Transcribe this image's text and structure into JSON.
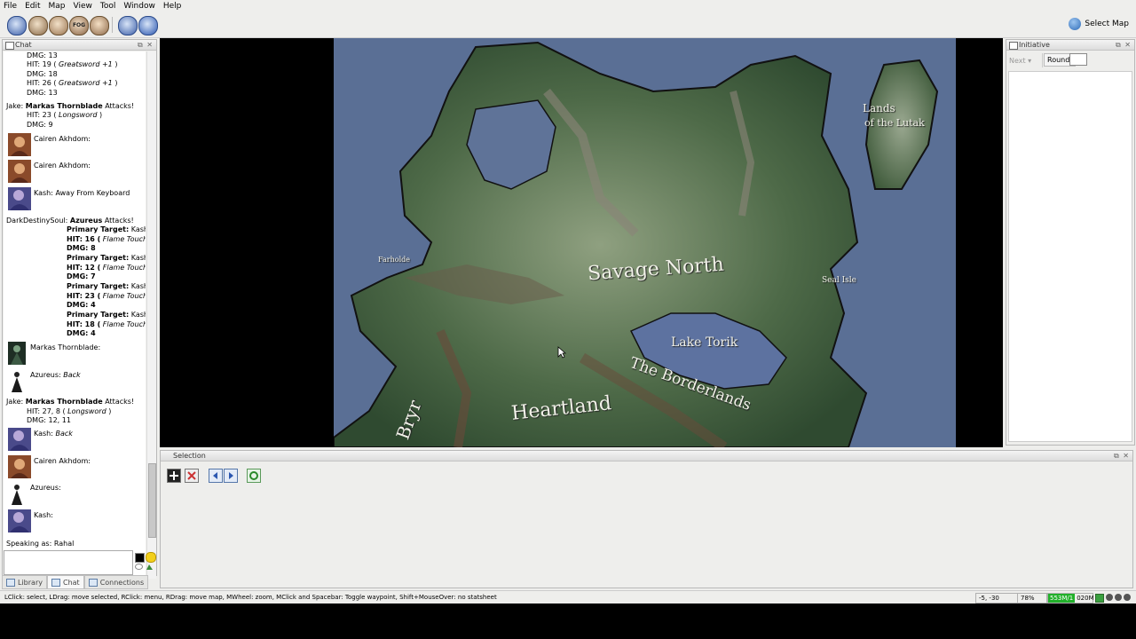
{
  "menu": [
    "File",
    "Edit",
    "Map",
    "View",
    "Tool",
    "Window",
    "Help"
  ],
  "toolbar": {
    "select_map_label": "Select Map",
    "fog_label": "FOG"
  },
  "chat": {
    "title": "Chat",
    "speaking_as": "Speaking as: Rahal",
    "lines": {
      "l1": "DMG: 13",
      "l2_pre": "HIT: 19 (",
      "l2_w": " Greatsword +1 ",
      "l2_post": ")",
      "l3": "DMG: 18",
      "l4_pre": "HIT: 26 (",
      "l4_w": " Greatsword +1 ",
      "l4_post": ")",
      "l5": "DMG: 13",
      "l6_pre": "Jake: ",
      "l6_name": "Markas Thornblade",
      "l6_post": " Attacks!",
      "l7_pre": "HIT: 23 (",
      "l7_w": " Longsword ",
      "l7_post": ")",
      "l8": "DMG: 9",
      "a1": "Cairen Akhdom:",
      "a2": "Cairen Akhdom:",
      "a3": "Kash:   Away From Keyboard",
      "d_pre": "DarkDestinySoul:  ",
      "d_name": "Azureus",
      "d_post": " Attacks!",
      "p1_lab": "Primary Target:",
      "p1_val": " Kash",
      "h1_pre": "HIT: 16 (",
      "h1_w": " Flame Touch ",
      "h1_post": ")",
      "g1": "DMG: 8",
      "p2_lab": "Primary Target:",
      "p2_val": " Kash",
      "h2_pre": "HIT: 12 (",
      "h2_w": " Flame Touch ",
      "h2_post": ")",
      "g2": "DMG: 7",
      "p3_lab": "Primary Target:",
      "p3_val": " Kash",
      "h3_pre": "HIT: 23 (",
      "h3_w": " Flame Touch ",
      "h3_post": ")",
      "g3": "DMG: 4",
      "p4_lab": "Primary Target:",
      "p4_val": " Kash",
      "h4_pre": "HIT: 18 (",
      "h4_w": " Flame Touch ",
      "h4_post": ")",
      "g4": "DMG: 4",
      "a4": "Markas Thornblade:",
      "a5_pre": "Azureus:   ",
      "a5_w": "Back",
      "j2_pre": "Jake: ",
      "j2_name": "Markas Thornblade",
      "j2_post": " Attacks!",
      "j2_hit_pre": "HIT: 27, 8 (",
      "j2_hit_w": " Longsword ",
      "j2_hit_post": ")",
      "j2_dmg": "DMG: 12, 11",
      "a6_pre": "Kash:   ",
      "a6_w": "Back",
      "a7": "Cairen Akhdom:",
      "a8": "Azureus:",
      "a9": "Kash:"
    }
  },
  "tabs": [
    "Library",
    "Chat",
    "Connections"
  ],
  "map_labels": {
    "lands_1": "Lands",
    "lands_2": "of the Lutak",
    "savage": "Savage North",
    "farholde": "Farholde",
    "seal": "Seal Isle",
    "lake": "Lake Torik",
    "border": "The Borderlands",
    "heart": "Heartland",
    "bryr": "Bryr"
  },
  "initiative": {
    "title": "Initiative",
    "next": "Next",
    "round": "Round:"
  },
  "selection": {
    "title": "Selection"
  },
  "status": {
    "hint": "LClick: select, LDrag: move selected, RClick: menu, RDrag: move map, MWheel: zoom, MClick and Spacebar: Toggle waypoint, Shift+MouseOver: no statsheet",
    "coords": "-5, -30",
    "zoom": "78%",
    "mem_used": "553M/1",
    "mem_total": "020M"
  },
  "colors": {
    "memory_green": "#21b02a",
    "chat_bg": "#ffffff",
    "panel_bg": "#eeeeec"
  }
}
